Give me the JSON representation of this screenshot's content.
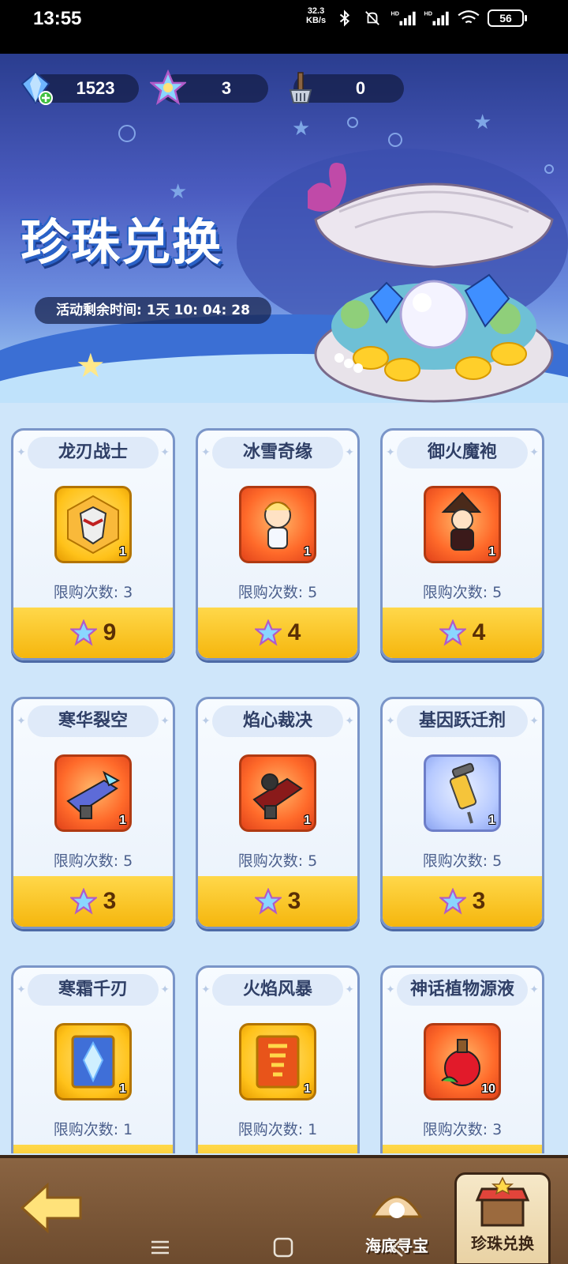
{
  "status_bar": {
    "time": "13:55",
    "net_speed_top": "32.3",
    "net_speed_bottom": "KB/s",
    "battery": "56"
  },
  "currencies": [
    {
      "name": "diamond",
      "value": "1523"
    },
    {
      "name": "star",
      "value": "3"
    },
    {
      "name": "shovel",
      "value": "0"
    }
  ],
  "banner": {
    "title": "珍珠兑换",
    "countdown": "活动剩余时间: 1天 10: 04: 28"
  },
  "shop": {
    "items": [
      {
        "name": "龙刃战士",
        "limit": "限购次数: 3",
        "price": "9",
        "qty": "1"
      },
      {
        "name": "冰雪奇缘",
        "limit": "限购次数: 5",
        "price": "4",
        "qty": "1"
      },
      {
        "name": "御火魔袍",
        "limit": "限购次数: 5",
        "price": "4",
        "qty": "1"
      },
      {
        "name": "寒华裂空",
        "limit": "限购次数: 5",
        "price": "3",
        "qty": "1"
      },
      {
        "name": "焰心裁决",
        "limit": "限购次数: 5",
        "price": "3",
        "qty": "1"
      },
      {
        "name": "基因跃迁剂",
        "limit": "限购次数: 5",
        "price": "3",
        "qty": "1"
      },
      {
        "name": "寒霜千刃",
        "limit": "限购次数: 1",
        "price": "",
        "qty": "1"
      },
      {
        "name": "火焰风暴",
        "limit": "限购次数: 1",
        "price": "",
        "qty": "1"
      },
      {
        "name": "神话植物源液",
        "limit": "限购次数: 3",
        "price": "",
        "qty": "10"
      }
    ]
  },
  "bottom_nav": {
    "tab_treasure": "海底寻宝",
    "tab_exchange": "珍珠兑换"
  }
}
